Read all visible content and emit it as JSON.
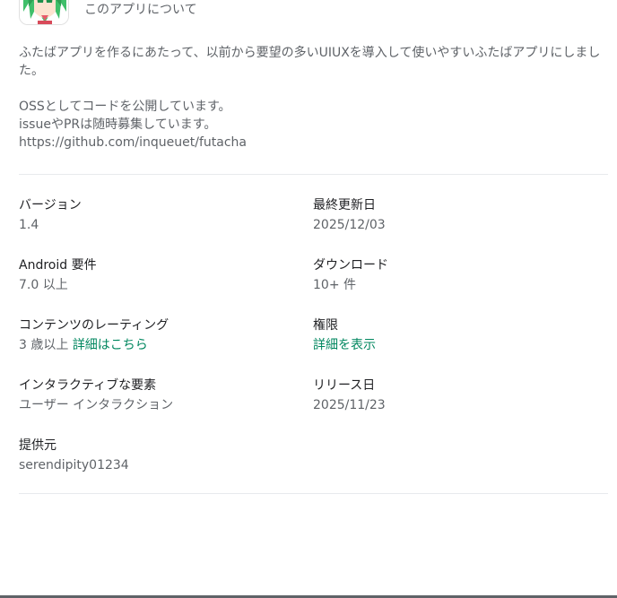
{
  "header": {
    "title": "このアプリについて"
  },
  "description": {
    "line1": "ふたばアプリを作るにあたって、以前から要望の多いUIUXを導入して使いやすいふたばアプリにしました。",
    "line2": "OSSとしてコードを公開しています。",
    "line3": "issueやPRは随時募集しています。",
    "line4": "https://github.com/inqueuet/futacha"
  },
  "info": {
    "version": {
      "label": "バージョン",
      "value": "1.4"
    },
    "updated": {
      "label": "最終更新日",
      "value": "2025/12/03"
    },
    "android": {
      "label": "Android 要件",
      "value": "7.0 以上"
    },
    "downloads": {
      "label": "ダウンロード",
      "value": "10+ 件"
    },
    "rating": {
      "label": "コンテンツのレーティング",
      "value": "3 歳以上",
      "link": "詳細はこちら"
    },
    "permissions": {
      "label": "権限",
      "link": "詳細を表示"
    },
    "interactive": {
      "label": "インタラクティブな要素",
      "value": "ユーザー インタラクション"
    },
    "release": {
      "label": "リリース日",
      "value": "2025/11/23"
    },
    "offered_by": {
      "label": "提供元",
      "value": "serendipity01234"
    }
  },
  "colors": {
    "link": "#01875f",
    "secondary_text": "#5f6368",
    "primary_text": "#202124"
  },
  "icons": {
    "app": "app-icon-anime-character"
  }
}
